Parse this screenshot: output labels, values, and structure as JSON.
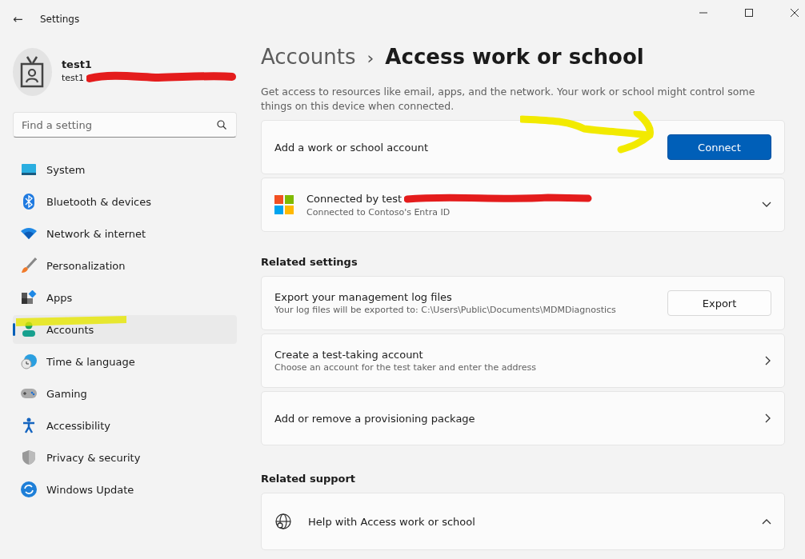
{
  "window": {
    "title": "Settings",
    "back": "←"
  },
  "user": {
    "name": "test1",
    "email": "test1"
  },
  "search": {
    "placeholder": "Find a setting"
  },
  "nav": [
    {
      "label": "System",
      "selected": false
    },
    {
      "label": "Bluetooth & devices",
      "selected": false
    },
    {
      "label": "Network & internet",
      "selected": false
    },
    {
      "label": "Personalization",
      "selected": false
    },
    {
      "label": "Apps",
      "selected": false
    },
    {
      "label": "Accounts",
      "selected": true
    },
    {
      "label": "Time & language",
      "selected": false
    },
    {
      "label": "Gaming",
      "selected": false
    },
    {
      "label": "Accessibility",
      "selected": false
    },
    {
      "label": "Privacy & security",
      "selected": false
    },
    {
      "label": "Windows Update",
      "selected": false
    }
  ],
  "breadcrumb": {
    "parent": "Accounts",
    "separator": "›",
    "current": "Access work or school"
  },
  "description": "Get access to resources like email, apps, and the network. Your work or school might control some things on this device when connected.",
  "cards": [
    {
      "kind": "button",
      "title": "Add a work or school account",
      "button": "Connect",
      "primary": true
    },
    {
      "kind": "expander",
      "title": "Connected by test",
      "subtitle": "Connected to Contoso's Entra ID",
      "expanded": false
    }
  ],
  "sections": [
    {
      "heading": "Related settings",
      "cards": [
        {
          "kind": "button",
          "title": "Export your management log files",
          "subtitle": "Your log files will be exported to: C:\\Users\\Public\\Documents\\MDMDiagnostics",
          "button": "Export",
          "primary": false
        },
        {
          "kind": "link",
          "title": "Create a test-taking account",
          "subtitle": "Choose an account for the test taker and enter the address"
        },
        {
          "kind": "link",
          "title": "Add or remove a provisioning package"
        }
      ]
    },
    {
      "heading": "Related support",
      "cards": [
        {
          "kind": "help",
          "title": "Help with Access work or school",
          "expanded": true
        }
      ]
    }
  ]
}
